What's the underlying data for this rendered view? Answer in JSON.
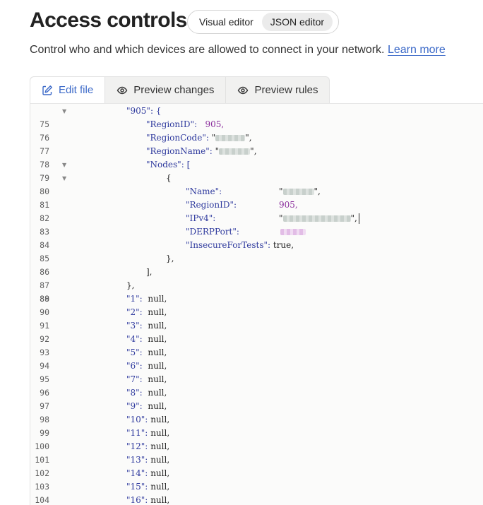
{
  "page": {
    "title": "Access controls",
    "subtitle": "Control who and which devices are allowed to connect in your network.",
    "learn_more": "Learn more"
  },
  "mode_toggle": {
    "visual": "Visual editor",
    "json": "JSON editor",
    "selected": "JSON editor"
  },
  "tabs": [
    {
      "label": "Edit file",
      "icon": "edit-icon",
      "active": true
    },
    {
      "label": "Preview changes",
      "icon": "eye-icon",
      "active": false
    },
    {
      "label": "Preview rules",
      "icon": "eye-icon",
      "active": false
    }
  ],
  "editor": {
    "lines": [
      {
        "n": "75",
        "fold": true
      },
      {
        "n": "76"
      },
      {
        "n": "77"
      },
      {
        "n": "78"
      },
      {
        "n": "79",
        "fold": true
      },
      {
        "n": "80",
        "fold": true
      },
      {
        "n": "81"
      },
      {
        "n": "82"
      },
      {
        "n": "83"
      },
      {
        "n": "84"
      },
      {
        "n": "85"
      },
      {
        "n": "86"
      },
      {
        "n": "87"
      },
      {
        "n": "88"
      },
      {
        "n": "89"
      },
      {
        "n": "90"
      },
      {
        "n": "91"
      },
      {
        "n": "92"
      },
      {
        "n": "93"
      },
      {
        "n": "94"
      },
      {
        "n": "95"
      },
      {
        "n": "96"
      },
      {
        "n": "97"
      },
      {
        "n": "98"
      },
      {
        "n": "99"
      },
      {
        "n": "100"
      },
      {
        "n": "101"
      },
      {
        "n": "102"
      },
      {
        "n": "103"
      },
      {
        "n": "104"
      }
    ],
    "region_key": "\"905\": {",
    "region_id_key": "\"RegionID\":",
    "region_id_val": "905,",
    "region_code_key": "\"RegionCode\":",
    "region_name_key": "\"RegionName\":",
    "nodes_key": "\"Nodes\": [",
    "open_brace": "{",
    "name_key": "\"Name\":",
    "node_region_id_key": "\"RegionID\":",
    "node_region_id_val": "905,",
    "ipv4_key": "\"IPv4\":",
    "derp_key": "\"DERPPort\":",
    "insecure_key": "\"InsecureForTests\":",
    "insecure_val": "true,",
    "close_brace_comma": "},",
    "close_bracket_comma": "],",
    "close_region": "},",
    "null_val": "null,",
    "null_keys": [
      "\"1\":",
      "\"2\":",
      "\"3\":",
      "\"4\":",
      "\"5\":",
      "\"6\":",
      "\"7\":",
      "\"8\":",
      "\"9\":",
      "\"10\":",
      "\"11\":",
      "\"12\":",
      "\"13\":",
      "\"14\":",
      "\"15\":",
      "\"16\":"
    ]
  },
  "colors": {
    "accent": "#3b69c8",
    "key": "#2f3a9e",
    "number": "#8a2d9c"
  }
}
